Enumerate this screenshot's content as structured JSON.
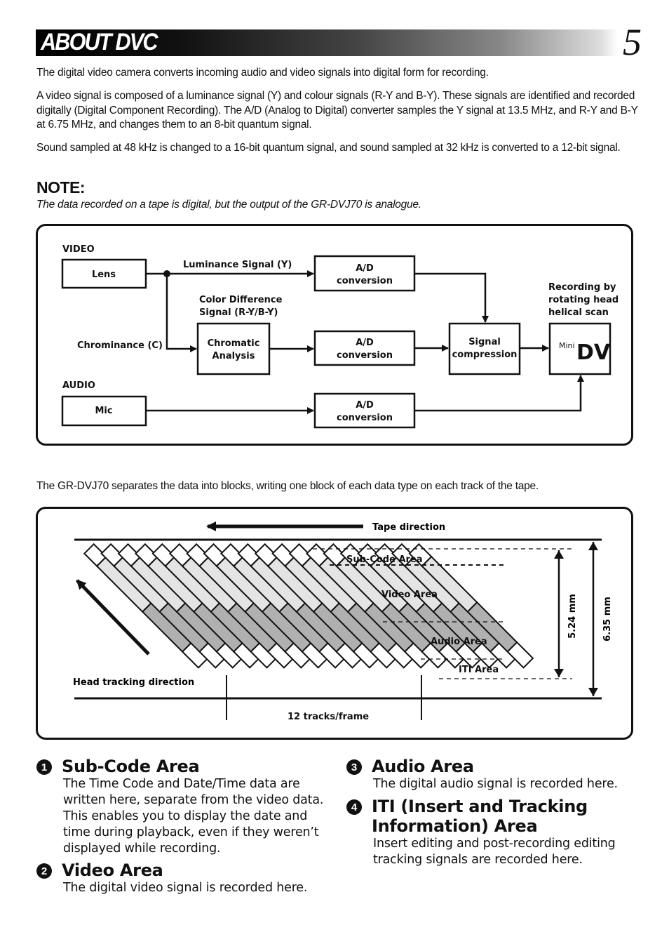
{
  "header": {
    "title": "ABOUT DVC",
    "page_number": "5"
  },
  "intro": {
    "paragraphs": [
      "The digital video camera converts incoming audio and video signals into digital form for recording.",
      "A video signal is composed of a luminance signal (Y) and colour signals (R-Y and B-Y). These signals are identified and recorded digitally (Digital Component Recording). The A/D (Analog to Digital) converter samples the Y signal at 13.5 MHz, and R-Y and B-Y at 6.75 MHz, and changes them to an 8-bit quantum signal.",
      "Sound sampled at 48 kHz is changed to a 16-bit quantum signal, and sound sampled at 32 kHz is converted to a 12-bit signal."
    ]
  },
  "note": {
    "title": "NOTE:",
    "text": "The data recorded on a tape is digital, but the output of the GR-DVJ70 is analogue."
  },
  "block_diagram": {
    "video_label": "VIDEO",
    "audio_label": "AUDIO",
    "lens": "Lens",
    "mic": "Mic",
    "luminance": "Luminance Signal (Y)",
    "color_diff_line1": "Color Difference",
    "color_diff_line2": "Signal (R-Y/B-Y)",
    "chrominance": "Chrominance (C)",
    "chromatic_line1": "Chromatic",
    "chromatic_line2": "Analysis",
    "ad_line1": "A/D",
    "ad_line2": "conversion",
    "compression_line1": "Signal",
    "compression_line2": "compression",
    "recording_line1": "Recording by",
    "recording_line2": "rotating head",
    "recording_line3": "helical scan",
    "minidv_small": "Mini",
    "minidv_big": "DV"
  },
  "separator_text": "The GR-DVJ70 separates the data into blocks, writing one block of each data type on each track of the tape.",
  "tape_diagram": {
    "tape_direction": "Tape direction",
    "head_tracking": "Head tracking direction",
    "tracks_per_frame": "12 tracks/frame",
    "track_count": 20,
    "areas": {
      "subcode": "Sub-Code Area",
      "video": "Video Area",
      "audio": "Audio Area",
      "iti": "ITI Area"
    },
    "dim_inner": "5.24 mm",
    "dim_outer": "6.35 mm",
    "colors": {
      "video": "#e4e4e4",
      "audio": "#b0b0b0",
      "subcode": "#ffffff",
      "iti": "#ffffff"
    }
  },
  "sections": [
    {
      "num": "1",
      "title": "Sub-Code Area",
      "body": "The Time Code and Date/Time data are written here, separate from the video data. This enables you to display the date and time during playback, even if they weren’t displayed while recording."
    },
    {
      "num": "2",
      "title": "Video Area",
      "body": "The digital video signal is recorded here."
    },
    {
      "num": "3",
      "title": "Audio Area",
      "body": "The digital audio signal is recorded here."
    },
    {
      "num": "4",
      "title": "ITI (Insert and Tracking Information) Area",
      "body": "Insert editing and post-recording editing tracking signals are recorded here."
    }
  ]
}
